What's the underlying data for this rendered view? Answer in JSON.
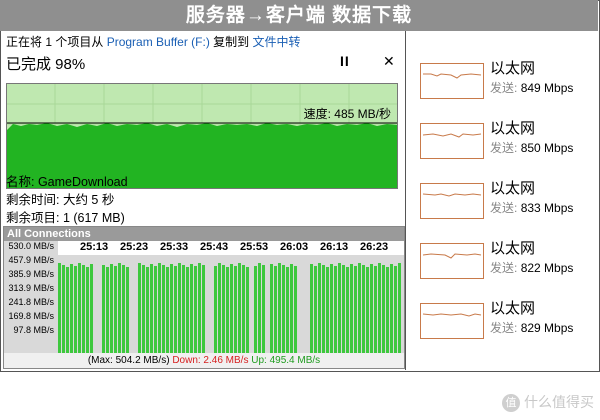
{
  "banner": {
    "title": "服务器→客户端 数据下载"
  },
  "copy": {
    "line_prefix": "正在将 1 个项目从",
    "source": "Program Buffer (F:)",
    "line_mid": "复制到",
    "destination": "文件中转",
    "percent_label": "已完成 98%",
    "percent_value": 98,
    "pause_icon": "pause-icon",
    "close_icon": "close-icon",
    "speed_label": "速度: 485 MB/秒",
    "name_label": "名称: GameDownload",
    "time_left_label": "剩余时间: 大约 5 秒",
    "items_left_label": "剩余项目: 1 (617 MB)"
  },
  "connections": {
    "title": "All Connections",
    "y_labels": [
      "530.0 MB/s",
      "457.9 MB/s",
      "385.9 MB/s",
      "313.9 MB/s",
      "241.8 MB/s",
      "169.8 MB/s",
      "97.8 MB/s"
    ],
    "time_labels": [
      "25:13",
      "25:23",
      "25:33",
      "25:43",
      "25:53",
      "26:03",
      "26:13",
      "26:23"
    ],
    "footer_max": "(Max: 504.2 MB/s)",
    "footer_down": "Down: 2.46 MB/s",
    "footer_up": "Up: 495.4 MB/s",
    "bar_color": "#3ec83e"
  },
  "ethernet": {
    "send_key": "发送:",
    "adapters": [
      {
        "name": "以太网",
        "rate": "849 Mbps"
      },
      {
        "name": "以太网",
        "rate": "850 Mbps"
      },
      {
        "name": "以太网",
        "rate": "833 Mbps"
      },
      {
        "name": "以太网",
        "rate": "822 Mbps"
      },
      {
        "name": "以太网",
        "rate": "829 Mbps"
      }
    ]
  },
  "watermark": {
    "text": "什么值得买",
    "icon": "值"
  },
  "colors": {
    "graph_fill": "#22b422",
    "graph_bg": "#bfe8b0",
    "accent_link": "#1a5fb4",
    "eth_border": "#c87a4a"
  }
}
